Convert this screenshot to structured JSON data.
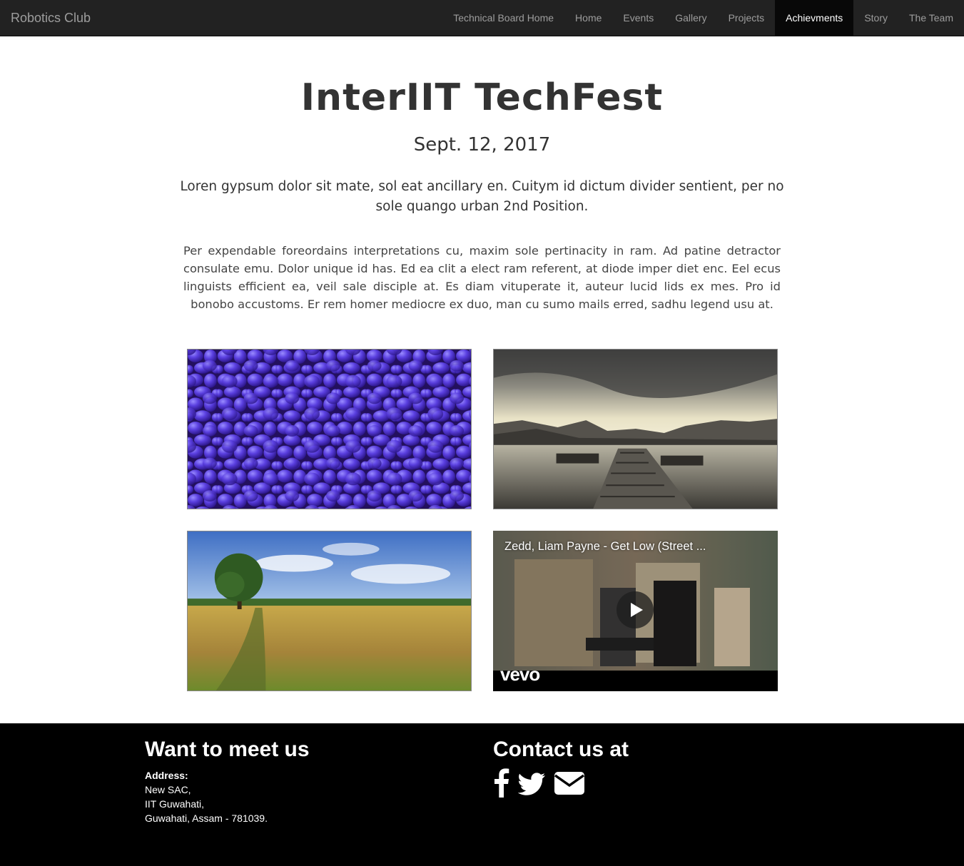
{
  "navbar": {
    "brand": "Robotics Club",
    "items": [
      {
        "label": "Technical Board Home",
        "active": false
      },
      {
        "label": "Home",
        "active": false
      },
      {
        "label": "Events",
        "active": false
      },
      {
        "label": "Gallery",
        "active": false
      },
      {
        "label": "Projects",
        "active": false
      },
      {
        "label": "Achievments",
        "active": true
      },
      {
        "label": "Story",
        "active": false
      },
      {
        "label": "The Team",
        "active": false
      }
    ]
  },
  "main": {
    "title": "InterIIT TechFest",
    "date": "Sept. 12, 2017",
    "lead": "Loren gypsum dolor sit mate, sol eat ancillary en. Cuitym id dictum divider sentient, per no sole quango urban 2nd Position.",
    "body": "Per expendable foreordains interpretations cu, maxim sole pertinacity in ram. Ad patine detractor consulate emu. Dolor unique id has. Ed ea clit a elect ram referent, at diode imper diet enc. Eel ecus linguists efficient ea, veil sale disciple at. Es diam vituperate it, auteur lucid lids ex mes. Pro id bonobo accustoms. Er rem homer mediocre ex duo, man cu sumo mails erred, sadhu legend usu at."
  },
  "gallery": {
    "video": {
      "title": "Zedd, Liam Payne - Get Low (Street ...",
      "logo": "vevo"
    }
  },
  "footer": {
    "meet_heading": "Want to meet us",
    "address_label": "Address:",
    "address_lines": [
      "New SAC,",
      "IIT Guwahati,",
      "Guwahati, Assam - 781039."
    ],
    "contact_heading": "Contact us at",
    "social_icons": [
      "facebook-icon",
      "twitter-icon",
      "envelope-icon"
    ]
  },
  "colors": {
    "navbar_bg": "#222222",
    "navbar_active_bg": "#080808",
    "navbar_text": "#9d9d9d",
    "footer_bg": "#000000"
  }
}
